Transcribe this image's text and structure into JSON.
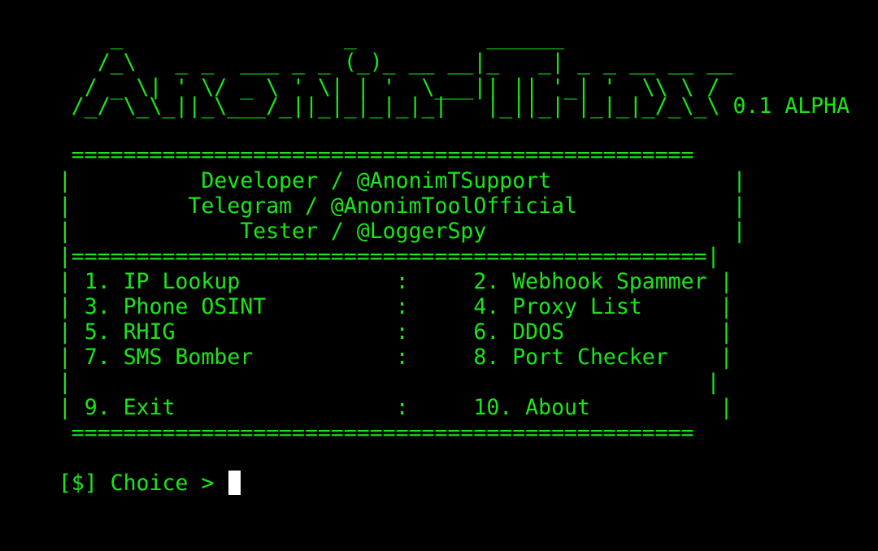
{
  "theme": {
    "background": "#000000",
    "foreground": "#19e619",
    "cursor": "#ffffff"
  },
  "banner": {
    "lines": [
      "    _                 _          ______",
      "   /_\\   _ _  ___ _ _ (_)_ __ __|_   _| _ _ __ __ __",
      "  / _ \\| ' \\/ _ \\ ' \\| | '  \\___|| || '_| '  \\\\ \\ /",
      " /_/ \\_\\_||_\\___/_||_|_|_|_|_|   |_||_| |_|_|_/_\\_\\"
    ],
    "version": " 0.1 ALPHA"
  },
  "box": {
    "top_border": " ================================================",
    "credit_lines": [
      "|          Developer / @AnonimTSupport              |",
      "|         Telegram / @AnonimToolOfficial            |",
      "|             Tester / @LoggerSpy                   |"
    ],
    "separator": "|=================================================|",
    "menu_rows": [
      "| 1. IP Lookup            :     2. Webhook Spammer |",
      "| 3. Phone OSINT          :     4. Proxy List      |",
      "| 5. RHIG                 :     6. DDOS            |",
      "| 7. SMS Bomber           :     8. Port Checker    |",
      "|                                                 |",
      "| 9. Exit                 :     10. About          |"
    ],
    "bottom_border": " ================================================"
  },
  "prompt": {
    "text": "[$] Choice > "
  }
}
